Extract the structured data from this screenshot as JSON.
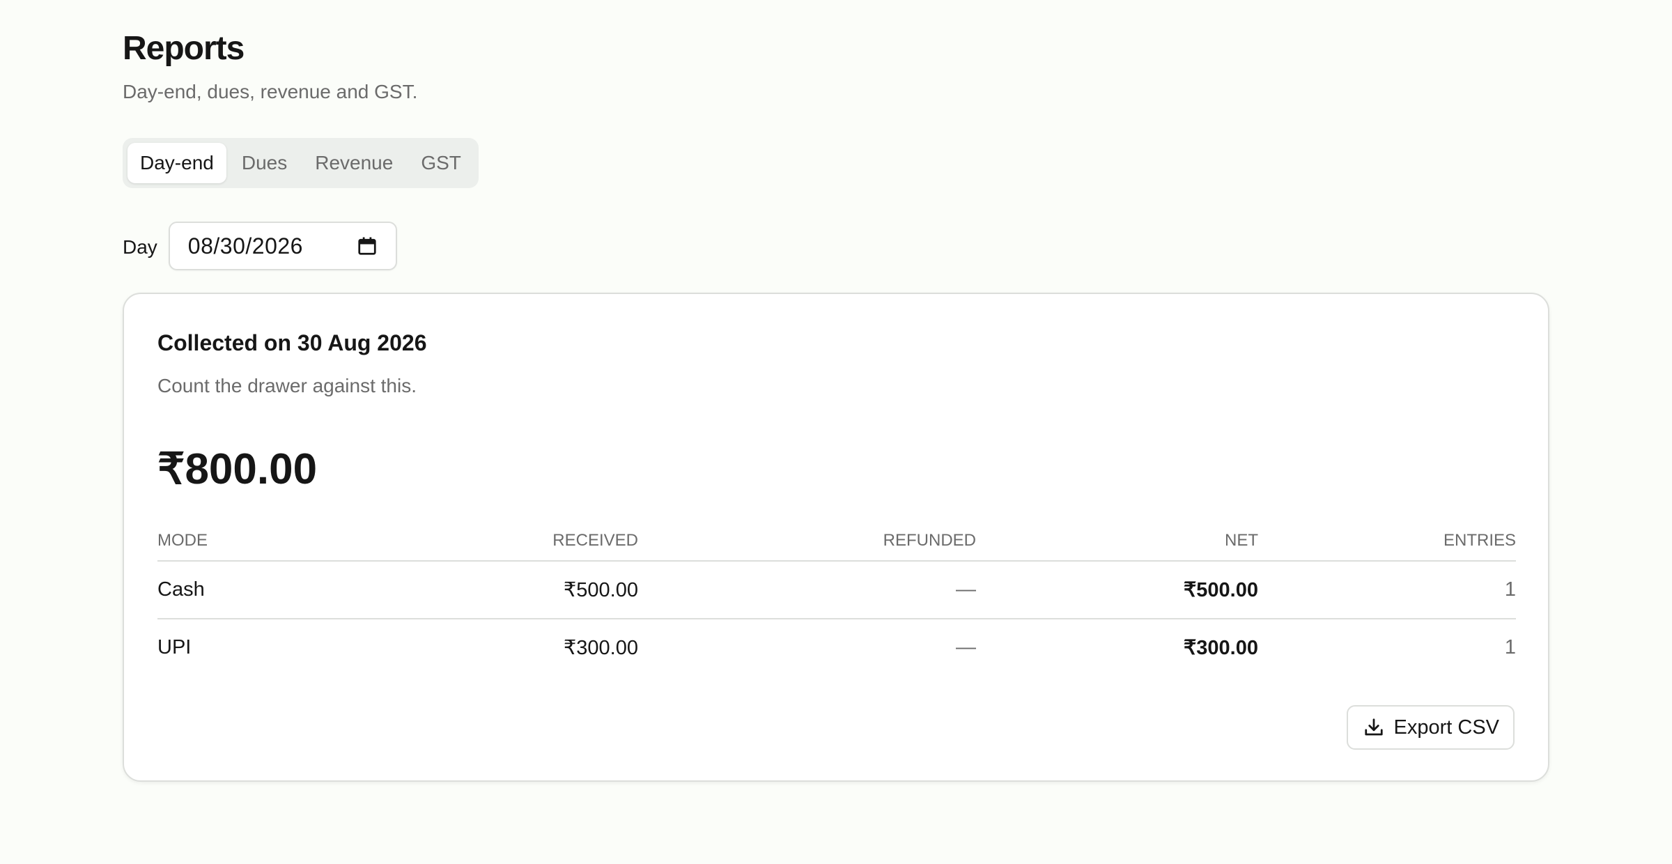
{
  "header": {
    "title": "Reports",
    "subtitle": "Day-end, dues, revenue and GST."
  },
  "tabs": [
    {
      "label": "Day-end",
      "active": true
    },
    {
      "label": "Dues",
      "active": false
    },
    {
      "label": "Revenue",
      "active": false
    },
    {
      "label": "GST",
      "active": false
    }
  ],
  "day_filter": {
    "label": "Day",
    "value": "08/30/2026",
    "icon": "calendar-icon"
  },
  "summary": {
    "title": "Collected on 30 Aug 2026",
    "subtitle": "Count the drawer against this.",
    "total": "₹800.00",
    "columns": [
      "Mode",
      "Received",
      "Refunded",
      "Net",
      "Entries"
    ],
    "rows": [
      {
        "mode": "Cash",
        "received": "₹500.00",
        "refunded": "—",
        "net": "₹500.00",
        "entries": "1"
      },
      {
        "mode": "UPI",
        "received": "₹300.00",
        "refunded": "—",
        "net": "₹300.00",
        "entries": "1"
      }
    ],
    "export_label": "Export CSV",
    "export_icon": "download-icon"
  },
  "colors": {
    "background": "#fbfdf9",
    "text": "#161616",
    "muted": "#6b6b6b",
    "border": "#dcdedb",
    "tab_track": "#ecefec"
  }
}
